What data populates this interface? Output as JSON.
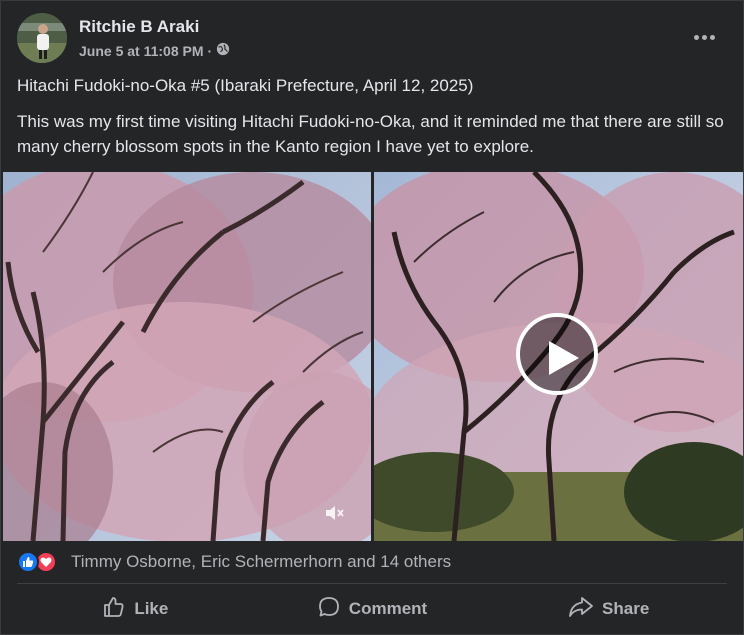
{
  "post": {
    "author": "Ritchie B Araki",
    "timestamp": "June 5 at 11:08 PM",
    "separator": "·",
    "title": "Hitachi Fudoki-no-Oka #5 (Ibaraki Prefecture, April 12, 2025)",
    "body": "This was my first time visiting Hitachi Fudoki-no-Oka, and it reminded me that there are still so many cherry blossom spots in the Kanto region I have yet to explore."
  },
  "reactions": {
    "summary": "Timmy Osborne, Eric Schermerhorn and 14 others"
  },
  "actions": {
    "like": "Like",
    "comment": "Comment",
    "share": "Share"
  },
  "colors": {
    "background": "#242526",
    "text_primary": "#e4e6eb",
    "text_secondary": "#b0b3b8",
    "like_blue": "#1877f2",
    "love_red": "#f33e58"
  },
  "icons": [
    "globe-icon",
    "more-options-icon",
    "play-icon",
    "mute-icon",
    "like-reaction-icon",
    "love-reaction-icon",
    "like-icon",
    "comment-icon",
    "share-icon"
  ]
}
